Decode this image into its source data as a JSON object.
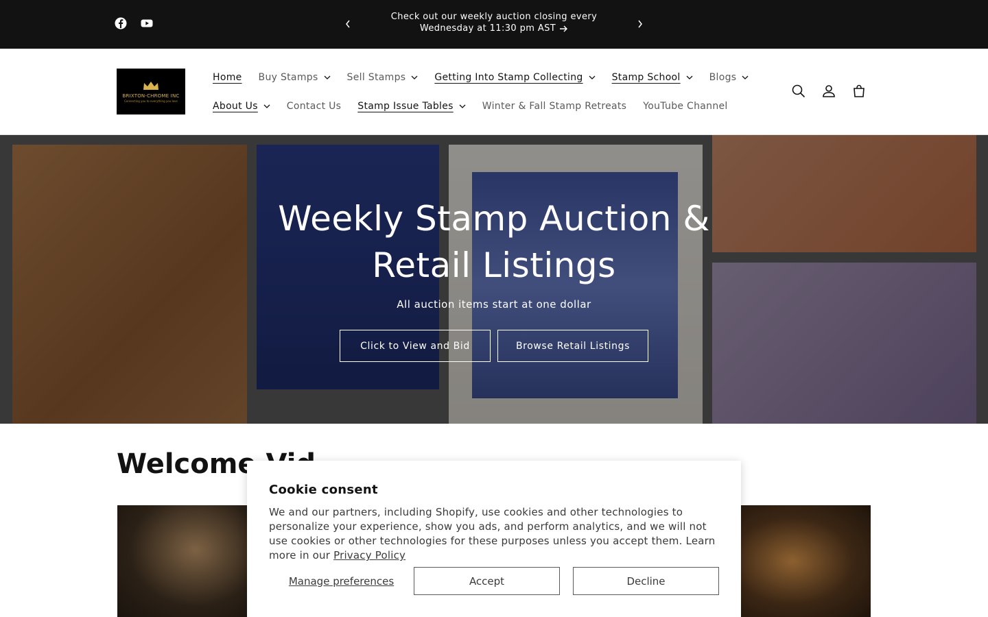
{
  "announcement": {
    "social": [
      {
        "name": "facebook-icon"
      },
      {
        "name": "youtube-icon"
      }
    ],
    "message": "Check out our weekly auction closing every Wednesday at 11:30 pm AST"
  },
  "header": {
    "logo": {
      "name": "BRIXTON-CHROME INC",
      "tagline": "Connecting you to everything you love"
    },
    "nav_row1": [
      {
        "label": "Home",
        "active": true,
        "dropdown": false
      },
      {
        "label": "Buy Stamps",
        "active": false,
        "dropdown": true
      },
      {
        "label": "Sell Stamps",
        "active": false,
        "dropdown": true
      },
      {
        "label": "Getting Into Stamp Collecting",
        "active": true,
        "dropdown": true
      },
      {
        "label": "Stamp School",
        "active": true,
        "dropdown": true
      },
      {
        "label": "Blogs",
        "active": false,
        "dropdown": true
      }
    ],
    "nav_row2": [
      {
        "label": "About Us",
        "active": true,
        "dropdown": true
      },
      {
        "label": "Contact Us",
        "active": false,
        "dropdown": false
      },
      {
        "label": "Stamp Issue Tables",
        "active": true,
        "dropdown": true
      },
      {
        "label": "Winter & Fall Stamp Retreats",
        "active": false,
        "dropdown": false
      },
      {
        "label": "YouTube Channel",
        "active": false,
        "dropdown": false
      }
    ],
    "icons": [
      "search-icon",
      "account-icon",
      "cart-icon"
    ]
  },
  "hero": {
    "title": "Weekly Stamp Auction & Retail Listings",
    "subtitle": "All auction items start at one dollar",
    "button_bid": "Click to View and Bid",
    "button_retail": "Browse Retail Listings"
  },
  "welcome": {
    "title": "Welcome Vid"
  },
  "cookie": {
    "title": "Cookie consent",
    "body": "We and our partners, including Shopify, use cookies and other technologies to personalize your experience, show you ads, and perform analytics, and we will not use cookies or other technologies for these purposes unless you accept them. Learn more in our ",
    "link": "Privacy Policy",
    "manage": "Manage preferences",
    "accept": "Accept",
    "decline": "Decline"
  }
}
